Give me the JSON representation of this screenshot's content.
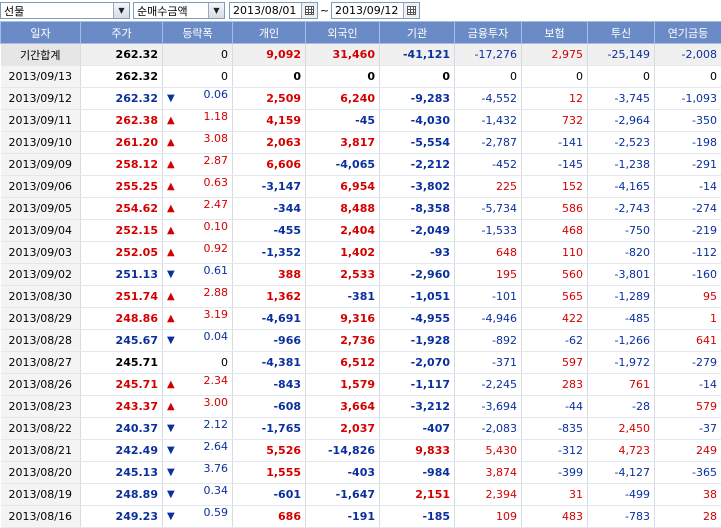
{
  "toolbar": {
    "market_select": "선물",
    "type_select": "순매수금액",
    "date_from": "2013/08/01",
    "date_separator": "~",
    "date_to": "2013/09/12"
  },
  "columns": [
    "일자",
    "주가",
    "등락폭",
    "개인",
    "외국인",
    "기관",
    "금융투자",
    "보험",
    "투신",
    "연기금등"
  ],
  "colors": {
    "header_bg": "#6b8bc7",
    "up": "#d40000",
    "down": "#0a2f9e"
  },
  "summary": {
    "date": "기간합계",
    "price": "262.32",
    "change": "0",
    "dir": "",
    "individual": "9,092",
    "foreign": "31,460",
    "institution": "-41,121",
    "fin_invest": "-17,276",
    "insurance": "2,975",
    "trust": "-25,149",
    "pension": "-2,008"
  },
  "rows": [
    {
      "date": "2013/09/13",
      "price": "262.32",
      "change": "0",
      "dir": "",
      "individual": "0",
      "foreign": "0",
      "institution": "0",
      "fin_invest": "0",
      "insurance": "0",
      "trust": "0",
      "pension": "0"
    },
    {
      "date": "2013/09/12",
      "price": "262.32",
      "change": "0.06",
      "dir": "down",
      "individual": "2,509",
      "foreign": "6,240",
      "institution": "-9,283",
      "fin_invest": "-4,552",
      "insurance": "12",
      "trust": "-3,745",
      "pension": "-1,093"
    },
    {
      "date": "2013/09/11",
      "price": "262.38",
      "change": "1.18",
      "dir": "up",
      "individual": "4,159",
      "foreign": "-45",
      "institution": "-4,030",
      "fin_invest": "-1,432",
      "insurance": "732",
      "trust": "-2,964",
      "pension": "-350"
    },
    {
      "date": "2013/09/10",
      "price": "261.20",
      "change": "3.08",
      "dir": "up",
      "individual": "2,063",
      "foreign": "3,817",
      "institution": "-5,554",
      "fin_invest": "-2,787",
      "insurance": "-141",
      "trust": "-2,523",
      "pension": "-198"
    },
    {
      "date": "2013/09/09",
      "price": "258.12",
      "change": "2.87",
      "dir": "up",
      "individual": "6,606",
      "foreign": "-4,065",
      "institution": "-2,212",
      "fin_invest": "-452",
      "insurance": "-145",
      "trust": "-1,238",
      "pension": "-291"
    },
    {
      "date": "2013/09/06",
      "price": "255.25",
      "change": "0.63",
      "dir": "up",
      "individual": "-3,147",
      "foreign": "6,954",
      "institution": "-3,802",
      "fin_invest": "225",
      "insurance": "152",
      "trust": "-4,165",
      "pension": "-14"
    },
    {
      "date": "2013/09/05",
      "price": "254.62",
      "change": "2.47",
      "dir": "up",
      "individual": "-344",
      "foreign": "8,488",
      "institution": "-8,358",
      "fin_invest": "-5,734",
      "insurance": "586",
      "trust": "-2,743",
      "pension": "-274"
    },
    {
      "date": "2013/09/04",
      "price": "252.15",
      "change": "0.10",
      "dir": "up",
      "individual": "-455",
      "foreign": "2,404",
      "institution": "-2,049",
      "fin_invest": "-1,533",
      "insurance": "468",
      "trust": "-750",
      "pension": "-219"
    },
    {
      "date": "2013/09/03",
      "price": "252.05",
      "change": "0.92",
      "dir": "up",
      "individual": "-1,352",
      "foreign": "1,402",
      "institution": "-93",
      "fin_invest": "648",
      "insurance": "110",
      "trust": "-820",
      "pension": "-112"
    },
    {
      "date": "2013/09/02",
      "price": "251.13",
      "change": "0.61",
      "dir": "down",
      "individual": "388",
      "foreign": "2,533",
      "institution": "-2,960",
      "fin_invest": "195",
      "insurance": "560",
      "trust": "-3,801",
      "pension": "-160"
    },
    {
      "date": "2013/08/30",
      "price": "251.74",
      "change": "2.88",
      "dir": "up",
      "individual": "1,362",
      "foreign": "-381",
      "institution": "-1,051",
      "fin_invest": "-101",
      "insurance": "565",
      "trust": "-1,289",
      "pension": "95"
    },
    {
      "date": "2013/08/29",
      "price": "248.86",
      "change": "3.19",
      "dir": "up",
      "individual": "-4,691",
      "foreign": "9,316",
      "institution": "-4,955",
      "fin_invest": "-4,946",
      "insurance": "422",
      "trust": "-485",
      "pension": "1"
    },
    {
      "date": "2013/08/28",
      "price": "245.67",
      "change": "0.04",
      "dir": "down",
      "individual": "-966",
      "foreign": "2,736",
      "institution": "-1,928",
      "fin_invest": "-892",
      "insurance": "-62",
      "trust": "-1,266",
      "pension": "641"
    },
    {
      "date": "2013/08/27",
      "price": "245.71",
      "change": "0",
      "dir": "",
      "individual": "-4,381",
      "foreign": "6,512",
      "institution": "-2,070",
      "fin_invest": "-371",
      "insurance": "597",
      "trust": "-1,972",
      "pension": "-279"
    },
    {
      "date": "2013/08/26",
      "price": "245.71",
      "change": "2.34",
      "dir": "up",
      "individual": "-843",
      "foreign": "1,579",
      "institution": "-1,117",
      "fin_invest": "-2,245",
      "insurance": "283",
      "trust": "761",
      "pension": "-14"
    },
    {
      "date": "2013/08/23",
      "price": "243.37",
      "change": "3.00",
      "dir": "up",
      "individual": "-608",
      "foreign": "3,664",
      "institution": "-3,212",
      "fin_invest": "-3,694",
      "insurance": "-44",
      "trust": "-28",
      "pension": "579"
    },
    {
      "date": "2013/08/22",
      "price": "240.37",
      "change": "2.12",
      "dir": "down",
      "individual": "-1,765",
      "foreign": "2,037",
      "institution": "-407",
      "fin_invest": "-2,083",
      "insurance": "-835",
      "trust": "2,450",
      "pension": "-37"
    },
    {
      "date": "2013/08/21",
      "price": "242.49",
      "change": "2.64",
      "dir": "down",
      "individual": "5,526",
      "foreign": "-14,826",
      "institution": "9,833",
      "fin_invest": "5,430",
      "insurance": "-312",
      "trust": "4,723",
      "pension": "249"
    },
    {
      "date": "2013/08/20",
      "price": "245.13",
      "change": "3.76",
      "dir": "down",
      "individual": "1,555",
      "foreign": "-403",
      "institution": "-984",
      "fin_invest": "3,874",
      "insurance": "-399",
      "trust": "-4,127",
      "pension": "-365"
    },
    {
      "date": "2013/08/19",
      "price": "248.89",
      "change": "0.34",
      "dir": "down",
      "individual": "-601",
      "foreign": "-1,647",
      "institution": "2,151",
      "fin_invest": "2,394",
      "insurance": "31",
      "trust": "-499",
      "pension": "38"
    },
    {
      "date": "2013/08/16",
      "price": "249.23",
      "change": "0.59",
      "dir": "down",
      "individual": "686",
      "foreign": "-191",
      "institution": "-185",
      "fin_invest": "109",
      "insurance": "483",
      "trust": "-783",
      "pension": "28"
    }
  ]
}
